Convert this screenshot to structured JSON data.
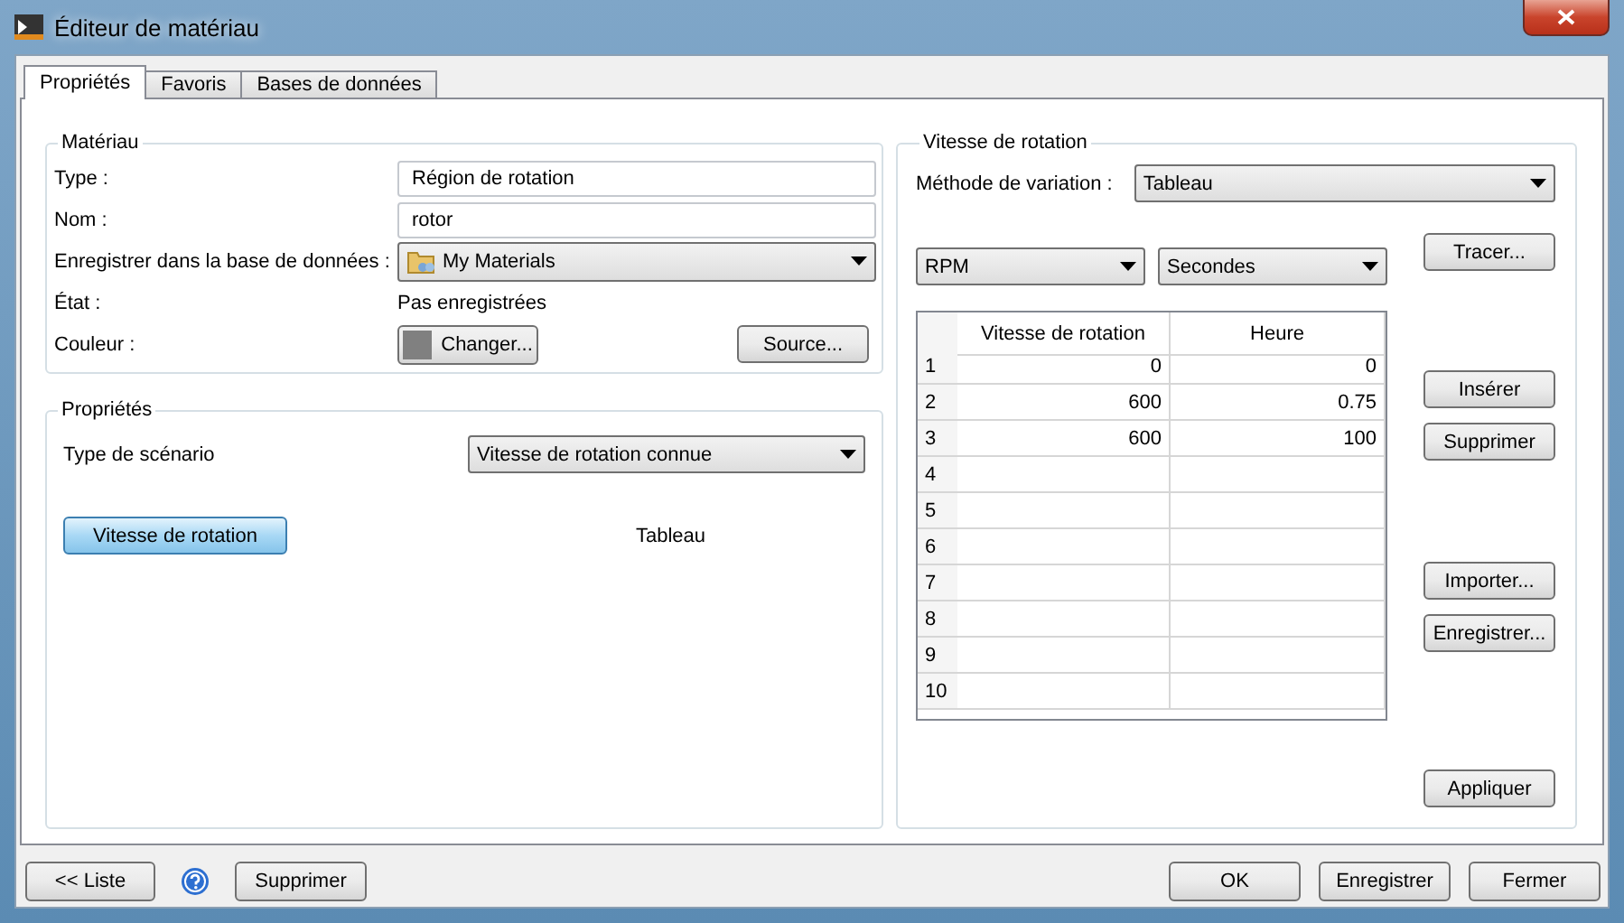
{
  "window": {
    "title": "Éditeur de matériau"
  },
  "tabs": [
    {
      "label": "Propriétés",
      "selected": true
    },
    {
      "label": "Favoris",
      "selected": false
    },
    {
      "label": "Bases de données",
      "selected": false
    }
  ],
  "material": {
    "title": "Matériau",
    "fields": [
      {
        "kind": "input",
        "label": "Type :",
        "value": "Région de rotation"
      },
      {
        "kind": "input",
        "label": "Nom :",
        "value": "rotor"
      },
      {
        "kind": "dropdown",
        "label": "Enregistrer dans la base de données :",
        "value": "My Materials"
      },
      {
        "kind": "text",
        "label": "État :",
        "value": "Pas enregistrées"
      },
      {
        "kind": "color",
        "label": "Couleur :",
        "value": "Changer...",
        "extra_button": "Source..."
      }
    ]
  },
  "properties": {
    "title": "Propriétés",
    "scenario_label": "Type de scénario",
    "scenario_value": "Vitesse de rotation connue",
    "speed_button": {
      "label": "Vitesse de rotation",
      "active": true
    },
    "speed_value": "Tableau"
  },
  "speed": {
    "title": "Vitesse de rotation",
    "method_label": "Méthode de variation :",
    "method_value": "Tableau",
    "units": [
      "RPM",
      "Secondes"
    ],
    "columns": [
      "Vitesse de rotation",
      "Heure"
    ],
    "rows": [
      {
        "index": "1",
        "speed": "0",
        "time": "0"
      },
      {
        "index": "2",
        "speed": "600",
        "time": "0.75"
      },
      {
        "index": "3",
        "speed": "600",
        "time": "100"
      },
      {
        "index": "4"
      },
      {
        "index": "5"
      },
      {
        "index": "6"
      },
      {
        "index": "7"
      },
      {
        "index": "8"
      },
      {
        "index": "9"
      },
      {
        "index": "10"
      }
    ],
    "buttons": [
      "Tracer...",
      "Insérer",
      "Supprimer",
      "Importer...",
      "Enregistrer...",
      "Appliquer"
    ]
  },
  "footer": {
    "left": [
      "<< Liste",
      "Supprimer"
    ],
    "right": [
      "OK",
      "Enregistrer",
      "Fermer"
    ]
  }
}
